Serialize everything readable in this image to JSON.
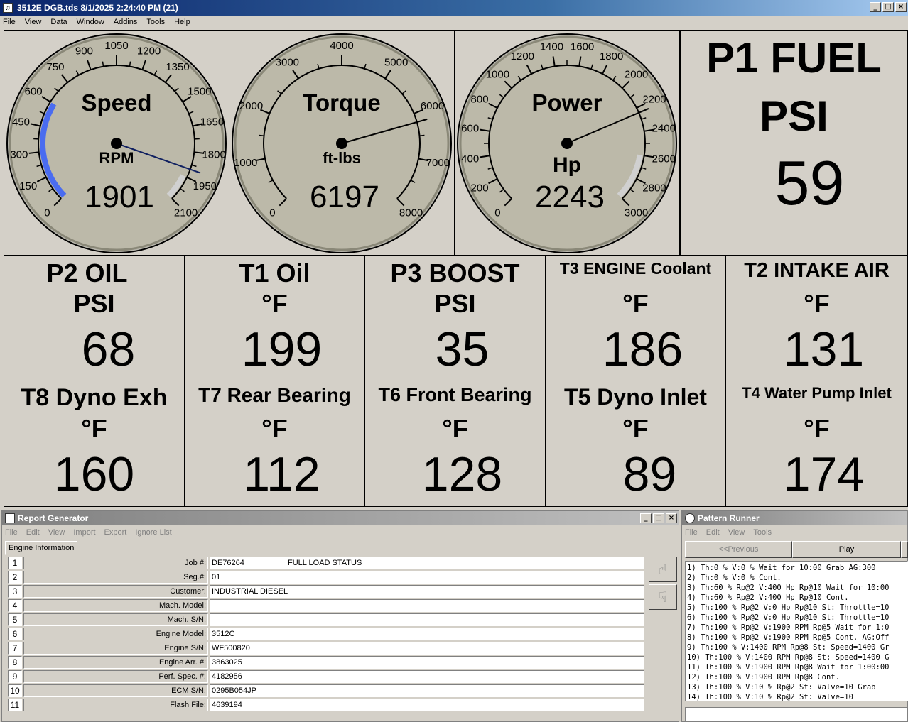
{
  "window": {
    "title": "3512E DGB.tds 8/1/2025 2:24:40 PM (21)",
    "menu": [
      "File",
      "View",
      "Data",
      "Window",
      "Addins",
      "Tools",
      "Help"
    ]
  },
  "gauges": [
    {
      "title": "Speed",
      "unit": "RPM",
      "value": "1901",
      "reading": 1901,
      "min": 0,
      "max": 2100,
      "ticks": [
        "0",
        "150",
        "300",
        "450",
        "600",
        "750",
        "900",
        "1050",
        "1200",
        "1350",
        "1500",
        "1650",
        "1800",
        "1950",
        "2100"
      ],
      "blue_range": [
        0,
        600
      ],
      "grey_range": [
        1950,
        2100
      ]
    },
    {
      "title": "Torque",
      "unit": "ft-lbs",
      "value": "6197",
      "reading": 6197,
      "min": 0,
      "max": 8000,
      "ticks": [
        "0",
        "1000",
        "2000",
        "3000",
        "4000",
        "5000",
        "6000",
        "7000",
        "8000"
      ],
      "blue_range": null,
      "grey_range": null
    },
    {
      "title": "Power",
      "unit": "Hp",
      "value": "2243",
      "reading": 2243,
      "min": 0,
      "max": 3000,
      "ticks": [
        "0",
        "200",
        "400",
        "600",
        "800",
        "1000",
        "1200",
        "1400",
        "1600",
        "1800",
        "2000",
        "2200",
        "2400",
        "2600",
        "2800",
        "3000"
      ],
      "blue_range": null,
      "grey_range": [
        2600,
        3000
      ]
    }
  ],
  "p1": {
    "label1": "P1 FUEL",
    "label2": "PSI",
    "value": "59"
  },
  "row1": [
    {
      "label": "P2 OIL",
      "unit": "PSI",
      "value": "68"
    },
    {
      "label": "T1 Oil",
      "unit": "°F",
      "value": "199"
    },
    {
      "label": "P3 BOOST",
      "unit": "PSI",
      "value": "35"
    },
    {
      "label": "T3 ENGINE Coolant",
      "unit": "°F",
      "value": "186"
    },
    {
      "label": "T2  INTAKE AIR",
      "unit": "°F",
      "value": "131"
    }
  ],
  "row2": [
    {
      "label": "T8 Dyno Exh",
      "unit": "°F",
      "value": "160"
    },
    {
      "label": "T7 Rear Bearing",
      "unit": "°F",
      "value": "112"
    },
    {
      "label": "T6 Front Bearing",
      "unit": "°F",
      "value": "128"
    },
    {
      "label": "T5 Dyno Inlet",
      "unit": "°F",
      "value": "89"
    },
    {
      "label": "T4 Water Pump Inlet",
      "unit": "°F",
      "value": "174"
    }
  ],
  "report": {
    "title": "Report Generator",
    "menu": [
      "File",
      "Edit",
      "View",
      "Import",
      "Export",
      "Ignore List"
    ],
    "tab": "Engine Information",
    "rows": [
      {
        "n": "1",
        "label": "Job #:",
        "value": "DE76264                    FULL LOAD STATUS"
      },
      {
        "n": "2",
        "label": "Seg.#:",
        "value": "01"
      },
      {
        "n": "3",
        "label": "Customer:",
        "value": "INDUSTRIAL DIESEL"
      },
      {
        "n": "4",
        "label": "Mach. Model:",
        "value": ""
      },
      {
        "n": "5",
        "label": "Mach. S/N:",
        "value": ""
      },
      {
        "n": "6",
        "label": "Engine Model:",
        "value": "3512C"
      },
      {
        "n": "7",
        "label": "Engine S/N:",
        "value": "WF500820"
      },
      {
        "n": "8",
        "label": "Engine Arr. #:",
        "value": "3863025"
      },
      {
        "n": "9",
        "label": "Perf. Spec. #:",
        "value": "4182956"
      },
      {
        "n": "10",
        "label": "ECM S/N:",
        "value": "0295B054JP"
      },
      {
        "n": "11",
        "label": "Flash File:",
        "value": "4639194"
      }
    ]
  },
  "pattern": {
    "title": "Pattern Runner",
    "menu": [
      "File",
      "Edit",
      "View",
      "Tools"
    ],
    "prev": "<<Previous",
    "play": "Play",
    "lines": [
      "1) Th:0 % V:0 % Wait for 10:00 Grab AG:300",
      "2) Th:0 % V:0 % Cont.",
      "3) Th:60 % Rp@2 V:400 Hp Rp@10 Wait for 10:00",
      "4) Th:60 % Rp@2 V:400 Hp Rp@10 Cont.",
      "5) Th:100 % Rp@2 V:0 Hp Rp@10 St: Throttle=10",
      "6) Th:100 % Rp@2 V:0 Hp Rp@10 St: Throttle=10",
      "7) Th:100 % Rp@2 V:1900 RPM Rp@5 Wait for 1:0",
      "8) Th:100 % Rp@2 V:1900 RPM Rp@5 Cont. AG:Off",
      "9) Th:100 % V:1400 RPM Rp@8 St: Speed=1400 Gr",
      "10) Th:100 % V:1400 RPM Rp@8 St: Speed=1400 G",
      "11) Th:100 % V:1900 RPM Rp@8 Wait for 1:00:00",
      "12) Th:100 % V:1900 RPM Rp@8 Cont.",
      "13) Th:100 % V:10 % Rp@2 St: Valve=10 Grab",
      "14) Th:100 % V:10 % Rp@2 St: Valve=10"
    ]
  }
}
